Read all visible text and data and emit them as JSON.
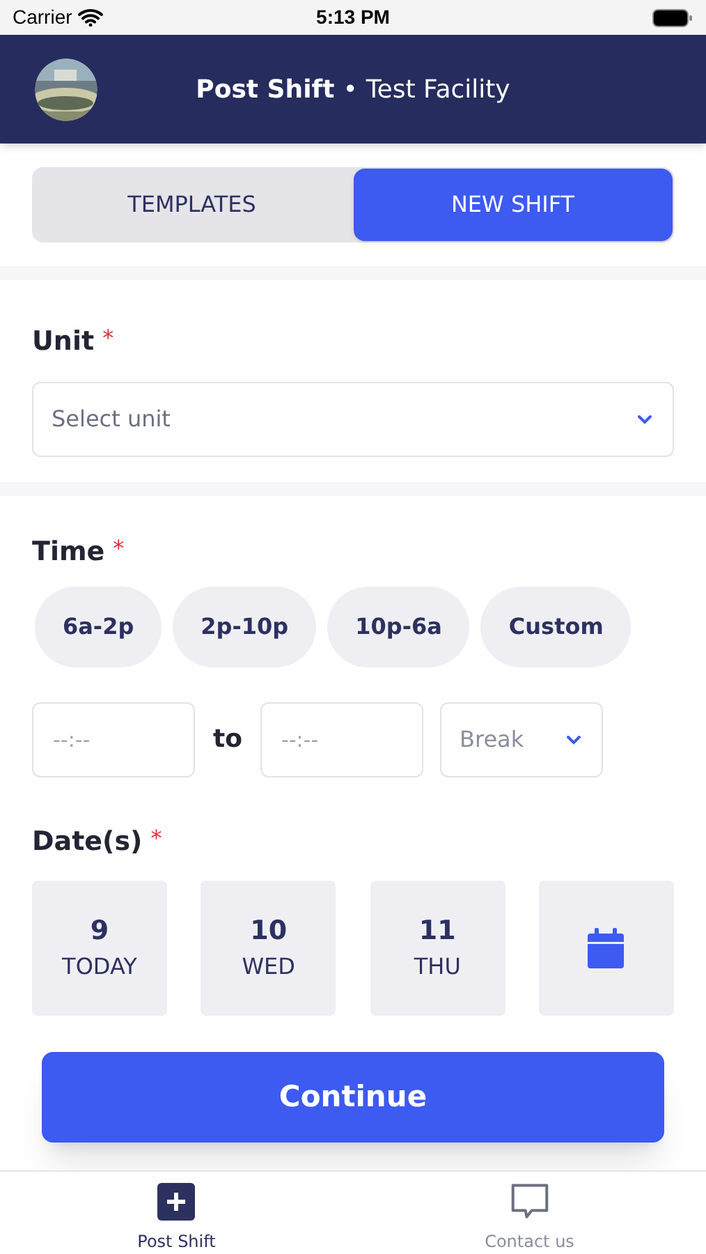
{
  "status_bar": {
    "carrier": "Carrier",
    "time": "5:13 PM"
  },
  "header": {
    "title": "Post Shift",
    "separator": "•",
    "subtitle": "Test Facility"
  },
  "segments": [
    {
      "label": "TEMPLATES",
      "selected": false
    },
    {
      "label": "NEW SHIFT",
      "selected": true
    }
  ],
  "unit": {
    "label": "Unit",
    "required": "*",
    "placeholder": "Select unit"
  },
  "time": {
    "label": "Time",
    "required": "*",
    "presets": [
      {
        "label": "6a-2p",
        "selected": false
      },
      {
        "label": "2p-10p",
        "selected": false
      },
      {
        "label": "10p-6a",
        "selected": false
      },
      {
        "label": "Custom",
        "selected": false
      }
    ],
    "start_placeholder": "--:--",
    "to": "to",
    "end_placeholder": "--:--",
    "break_placeholder": "Break"
  },
  "dates": {
    "label": "Date(s)",
    "required": "*",
    "items": [
      {
        "kind": "day",
        "day": "9",
        "weekday": "TODAY",
        "selected": false
      },
      {
        "kind": "day",
        "day": "10",
        "weekday": "WED",
        "selected": false
      },
      {
        "kind": "day",
        "day": "11",
        "weekday": "THU",
        "selected": false
      },
      {
        "kind": "calendar",
        "selected": false
      }
    ]
  },
  "continue_button": "Continue",
  "tab_bar": [
    {
      "kind": "post",
      "label": "Post Shift",
      "selected": true
    },
    {
      "kind": "contact",
      "label": "Contact us",
      "selected": false
    }
  ]
}
